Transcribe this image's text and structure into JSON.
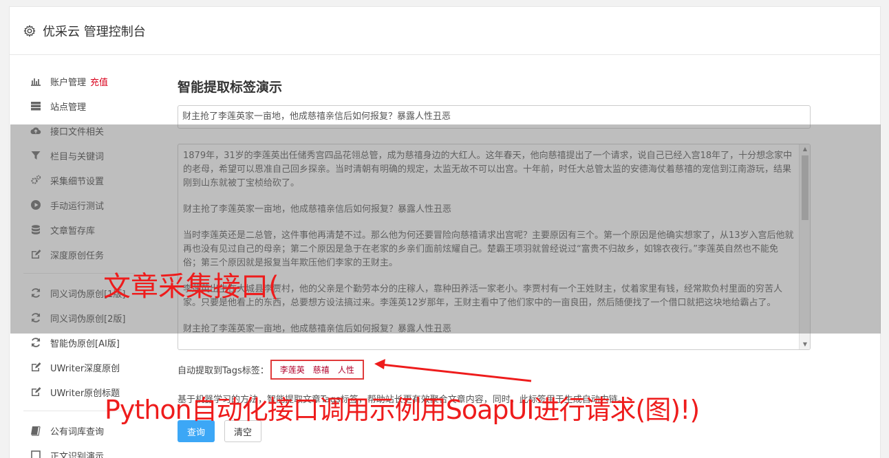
{
  "header": {
    "title": "优采云 管理控制台",
    "icon": "gear-icon"
  },
  "sidebar": {
    "group1": [
      {
        "label": "账户管理",
        "badge": "充值",
        "icon": "bar-chart-icon"
      },
      {
        "label": "站点管理",
        "icon": "server-icon"
      },
      {
        "label": "接口文件相关",
        "icon": "cloud-upload-icon"
      },
      {
        "label": "栏目与关键词",
        "icon": "filter-icon"
      },
      {
        "label": "采集细节设置",
        "icon": "gears-icon"
      },
      {
        "label": "手动运行测试",
        "icon": "play-circle-icon"
      },
      {
        "label": "文章暂存库",
        "icon": "database-icon"
      },
      {
        "label": "深度原创任务",
        "icon": "edit-icon"
      }
    ],
    "group2": [
      {
        "label": "同义词伪原创[1版]",
        "icon": "refresh-icon"
      },
      {
        "label": "同义词伪原创[2版]",
        "icon": "refresh-icon"
      },
      {
        "label": "智能伪原创[AI版]",
        "icon": "refresh-icon"
      },
      {
        "label": "UWriter深度原创",
        "icon": "edit-icon"
      },
      {
        "label": "UWriter原创标题",
        "icon": "edit-icon"
      }
    ],
    "group3": [
      {
        "label": "公有词库查询",
        "icon": "book-icon"
      },
      {
        "label": "正文识别演示",
        "icon": "square-icon"
      }
    ]
  },
  "main": {
    "page_title": "智能提取标签演示",
    "title_value": "财主抢了李莲英家一亩地，他成慈禧亲信后如何报复？暴露人性丑恶",
    "article_paragraphs": [
      "1879年，31岁的李莲英出任储秀宫四品花翎总管，成为慈禧身边的大红人。这年春天，他向慈禧提出了一个请求，说自己已经入宫18年了，十分想念家中的老母，希望可以恩准自己回乡探亲。当时清朝有明确的规定，太监无故不可以出宫。十年前，时任大总管太监的安德海仗着慈禧的宠信到江南游玩，结果刚到山东就被丁宝桢给砍了。",
      "财主抢了李莲英家一亩地，他成慈禧亲信后如何报复？暴露人性丑恶",
      "当时李莲英还是二总管，这件事他再清楚不过。那么他为何还要冒险向慈禧请求出宫呢？主要原因有三个。第一个原因是他确实想家了，从13岁入宫后他就再也没有见过自己的母亲；第二个原因是急于在老家的乡亲们面前炫耀自己。楚霸王项羽就曾经说过“富贵不归故乡，如锦衣夜行。”李莲英自然也不能免俗；第三个原因就是报复当年欺压他们李家的王财主。",
      "李莲英出生在大城县李贾村，他的父亲是个勤劳本分的庄稼人，靠种田养活一家老小。李贾村有一个王姓财主，仗着家里有钱，经常欺负村里面的穷苦人家。只要是他看上的东西，总要想方设法搞过来。李莲英12岁那年，王财主看中了他们家中的一亩良田，然后随便找了一个借口就把这块地给霸占了。",
      "财主抢了李莲英家一亩地，他成慈禧亲信后如何报复？暴露人性丑恶"
    ],
    "tags_label": "自动提取到Tags标签：",
    "tags": [
      "李莲英",
      "慈禧",
      "人性"
    ],
    "description": "基于机器学习的方法，智能提取文章Tags标签，帮助站长更有效聚合文章内容，同时，此标签用于生成自动内链。",
    "query_button": "查询",
    "clear_button": "清空"
  },
  "annotations": {
    "text1": "文章采集接口(",
    "text2": "Python自动化接口调用示例用SoapUI进行请求(图)!)",
    "color": "#ee1c1c"
  }
}
